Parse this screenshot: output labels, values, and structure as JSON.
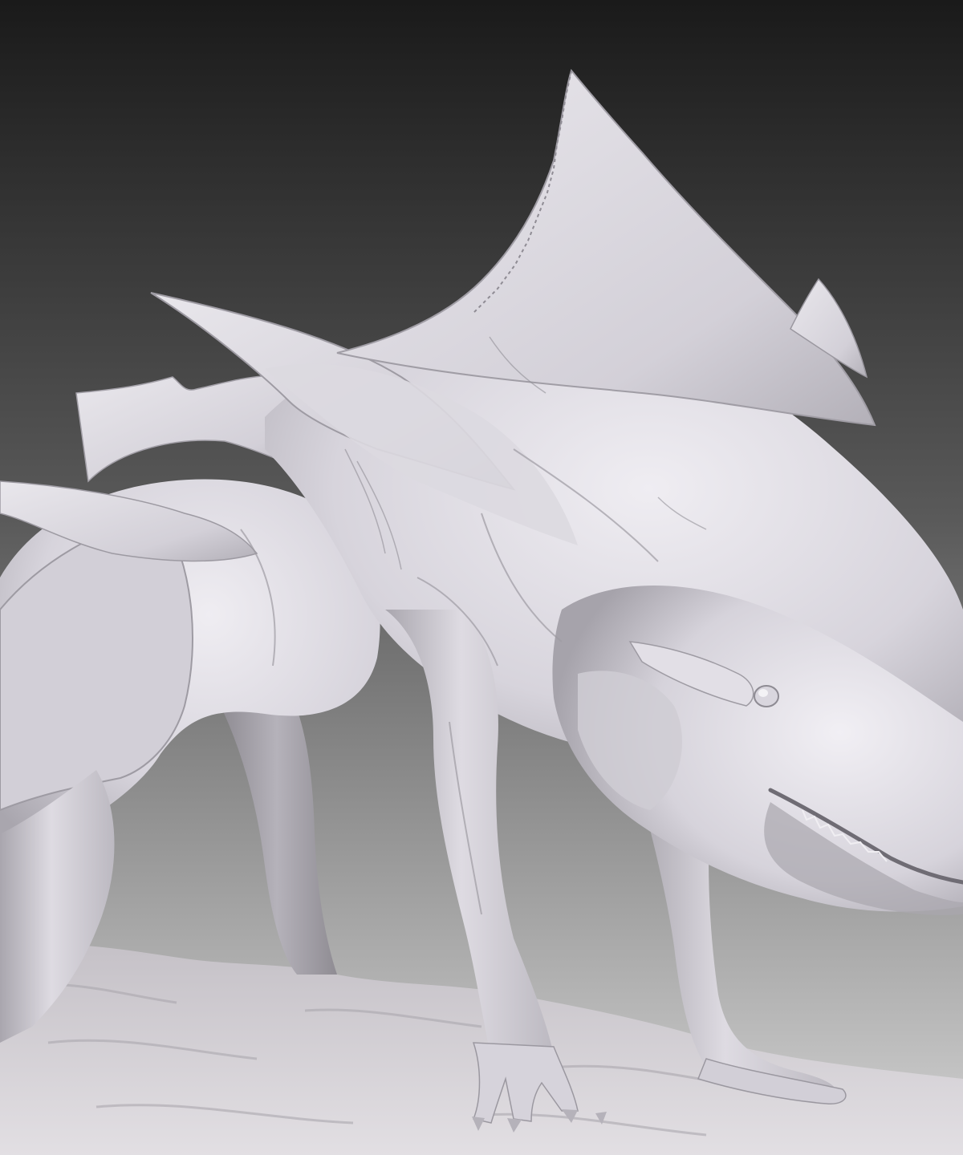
{
  "scene": {
    "subject": "finned-quadruped-sculpt",
    "material": "clay-matte",
    "colors": {
      "background_top": "#1a1a1a",
      "background_bottom": "#d2d2d2",
      "clay_base": "#d9d6de",
      "clay_highlight": "#eeecf1",
      "clay_shadow": "#9c99a2",
      "clay_deep_shadow": "#6c6a70",
      "ground": "#cfcbd0"
    }
  }
}
